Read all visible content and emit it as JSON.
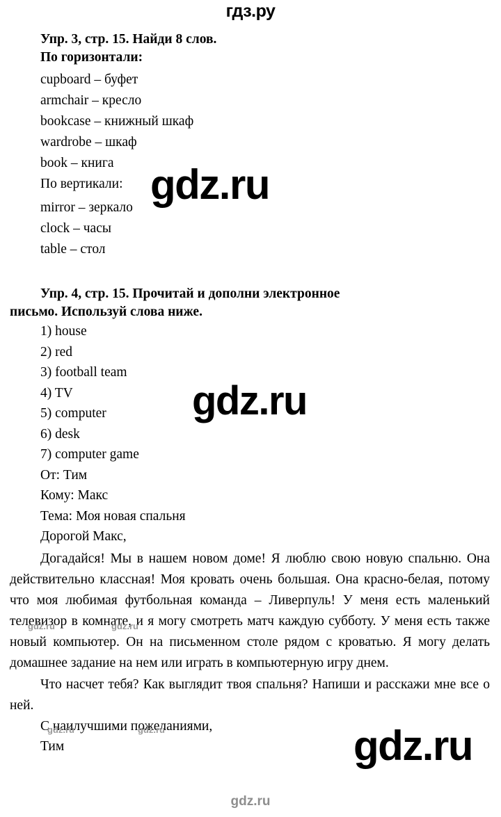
{
  "site": {
    "brand_top": "гдз.ру",
    "watermark_large": "gdz.ru",
    "watermark_small": "gdz.ru",
    "watermark_footer": "gdz.ru",
    "watermark_color_large": "#000000",
    "watermark_color_small": "#9a9a9a",
    "watermark_color_footer": "#8e8e8e"
  },
  "exercise3": {
    "heading": "Упр. 3, стр. 15. Найди 8 слов.",
    "across_label": "По горизонтали:",
    "across_words": [
      "cupboard – буфет",
      "armchair – кресло",
      "bookcase – книжный шкаф",
      "wardrobe – шкаф",
      "book – книга"
    ],
    "down_label": "По вертикали:",
    "down_words": [
      "mirror – зеркало",
      "clock – часы",
      "table – стол"
    ]
  },
  "exercise4": {
    "heading_line1": "Упр. 4, стр. 15. Прочитай и дополни электронное",
    "heading_line2": "письмо. Используй слова ниже.",
    "answers": [
      "1) house",
      "2) red",
      "3) football team",
      "4) TV",
      "5) computer",
      "6) desk",
      "7) computer game"
    ],
    "mail_header": [
      "От: Тим",
      "Кому: Макс",
      "Тема: Моя новая спальня",
      "Дорогой Макс,"
    ],
    "paragraph1": "Догадайся! Мы в нашем новом доме! Я люблю свою новую спальню. Она действительно классная! Моя кровать очень большая. Она красно-белая, потому что моя любимая футбольная команда – Ливерпуль! У меня есть маленький телевизор в комнате, и я могу смотреть матч каждую субботу. У меня есть также новый компьютер. Он на письменном столе рядом с кроватью. Я могу делать домашнее задание на нем или играть в компьютерную игру днем.",
    "paragraph2": "Что насчет тебя? Как выглядит твоя спальня? Напиши и расскажи мне все о ней.",
    "closing": [
      "С наилучшими пожеланиями,",
      "Тим"
    ]
  }
}
